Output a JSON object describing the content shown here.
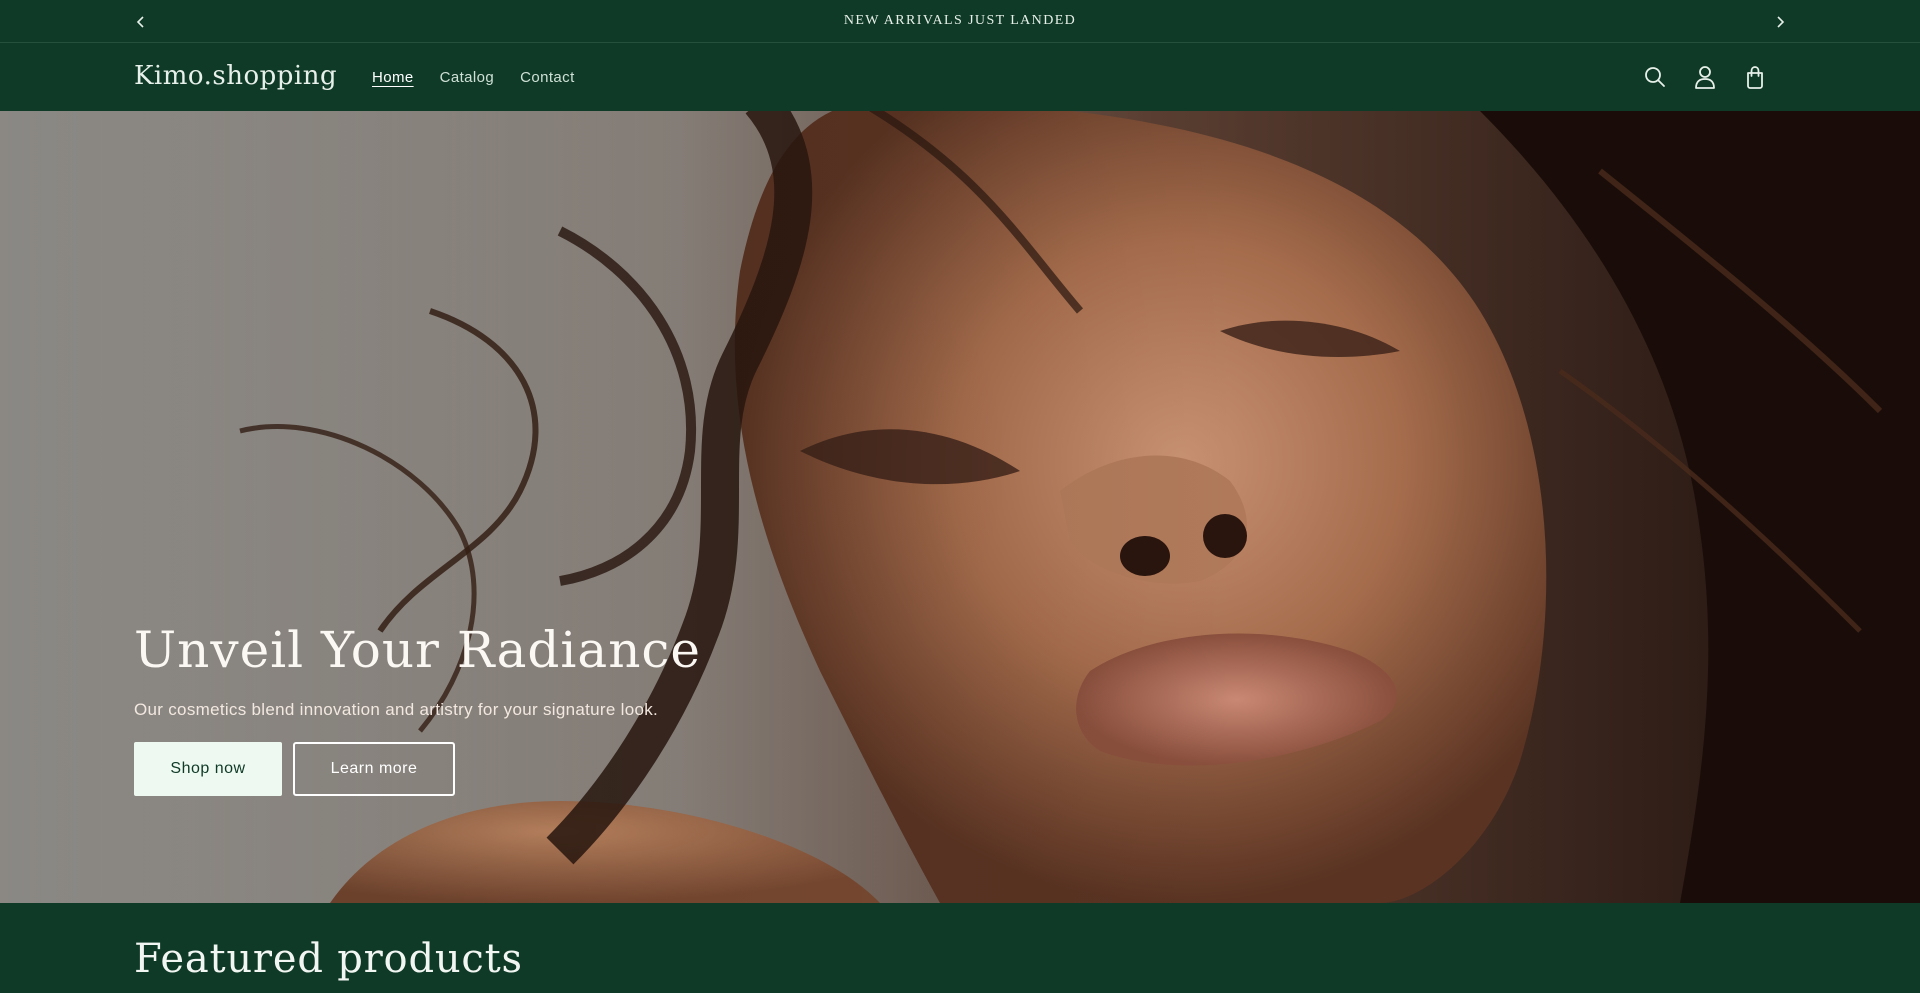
{
  "announcement": {
    "text": "NEW ARRIVALS JUST LANDED",
    "prev_icon": "chevron-left-icon",
    "next_icon": "chevron-right-icon"
  },
  "header": {
    "logo": "Kimo.shopping",
    "menu": [
      {
        "label": "Home",
        "active": true
      },
      {
        "label": "Catalog",
        "active": false
      },
      {
        "label": "Contact",
        "active": false
      }
    ],
    "icons": [
      "search-icon",
      "account-icon",
      "cart-icon"
    ]
  },
  "hero": {
    "title": "Unveil Your Radiance",
    "subtitle": "Our cosmetics blend innovation and artistry for your signature look.",
    "primary_button": "Shop now",
    "secondary_button": "Learn more"
  },
  "featured": {
    "title": "Featured products"
  },
  "colors": {
    "brand_green": "#0f3a27",
    "button_mint": "#eefaf1",
    "text_light": "#e7f0ea"
  }
}
